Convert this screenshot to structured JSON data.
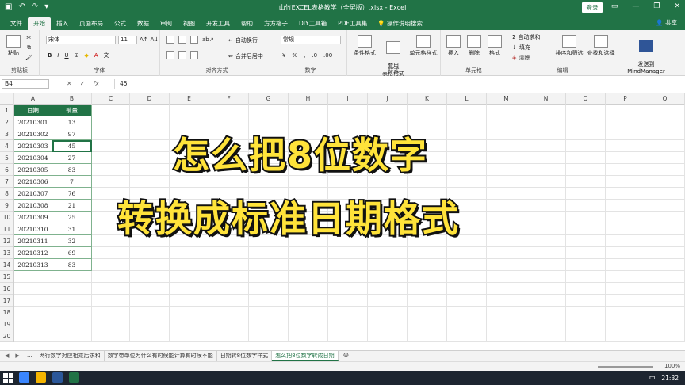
{
  "titlebar": {
    "title": "山竹EXCEL表格教学（全屏版）.xlsx - Excel",
    "login_label": "登录",
    "qat_icons": [
      "save-icon",
      "undo-icon",
      "redo-icon",
      "customize-icon"
    ]
  },
  "tabs": [
    "文件",
    "开始",
    "插入",
    "页面布局",
    "公式",
    "数据",
    "审阅",
    "视图",
    "开发工具",
    "帮助",
    "方方格子",
    "DIY工具箱",
    "PDF工具集"
  ],
  "tell_me": "操作说明搜索",
  "share_label": "共享",
  "ribbon": {
    "clipboard": {
      "paste": "粘贴",
      "label": "剪贴板"
    },
    "font": {
      "name": "宋体",
      "size": "11",
      "label": "字体"
    },
    "alignment": {
      "wrap": "自动换行",
      "merge": "合并后居中",
      "label": "对齐方式"
    },
    "number": {
      "format": "常规",
      "label": "数字"
    },
    "styles": {
      "cond": "条件格式",
      "table": "套用\n表格格式",
      "cell": "单元格样式",
      "label": "样式"
    },
    "cells": {
      "insert": "插入",
      "delete": "删除",
      "format": "格式",
      "label": "单元格"
    },
    "editing": {
      "autosum": "自动求和",
      "fill": "填充",
      "clear": "清除",
      "sort": "排序和筛选",
      "find": "查找和选择",
      "label": "编辑"
    },
    "mindmanager": {
      "send": "发送到\nMindManager",
      "label": "MindManager"
    }
  },
  "formula_bar": {
    "name_box": "B4",
    "value": "45"
  },
  "columns": [
    "A",
    "B",
    "C",
    "D",
    "E",
    "F",
    "G",
    "H",
    "I",
    "J",
    "K",
    "L",
    "M",
    "N",
    "O",
    "P",
    "Q"
  ],
  "rows": [
    "1",
    "2",
    "3",
    "4",
    "5",
    "6",
    "7",
    "8",
    "9",
    "10",
    "11",
    "12",
    "13",
    "14",
    "15",
    "16",
    "17",
    "18",
    "19",
    "20"
  ],
  "table": {
    "headers": [
      "日期",
      "销量"
    ],
    "rows": [
      [
        "20210301",
        "13"
      ],
      [
        "20210302",
        "97"
      ],
      [
        "20210303",
        "45"
      ],
      [
        "20210304",
        "27"
      ],
      [
        "20210305",
        "83"
      ],
      [
        "20210306",
        "7"
      ],
      [
        "20210307",
        "76"
      ],
      [
        "20210308",
        "21"
      ],
      [
        "20210309",
        "25"
      ],
      [
        "20210310",
        "31"
      ],
      [
        "20210311",
        "32"
      ],
      [
        "20210312",
        "69"
      ],
      [
        "20210313",
        "83"
      ]
    ]
  },
  "overlay": {
    "line1": "怎么把8位数字",
    "line2": "转换成标准日期格式"
  },
  "sheet_tabs": [
    "...",
    "两行数字对应相乘后求和",
    "数字带单位为什么有时候能计算有时候不能",
    "日期转8位数字样式",
    "怎么把8位数字转成日期"
  ],
  "active_sheet": 4,
  "zoom": "100%",
  "clock": "21:32",
  "ime": "中",
  "colors": {
    "excel_green": "#217346",
    "overlay_yellow": "#ffe33a"
  }
}
